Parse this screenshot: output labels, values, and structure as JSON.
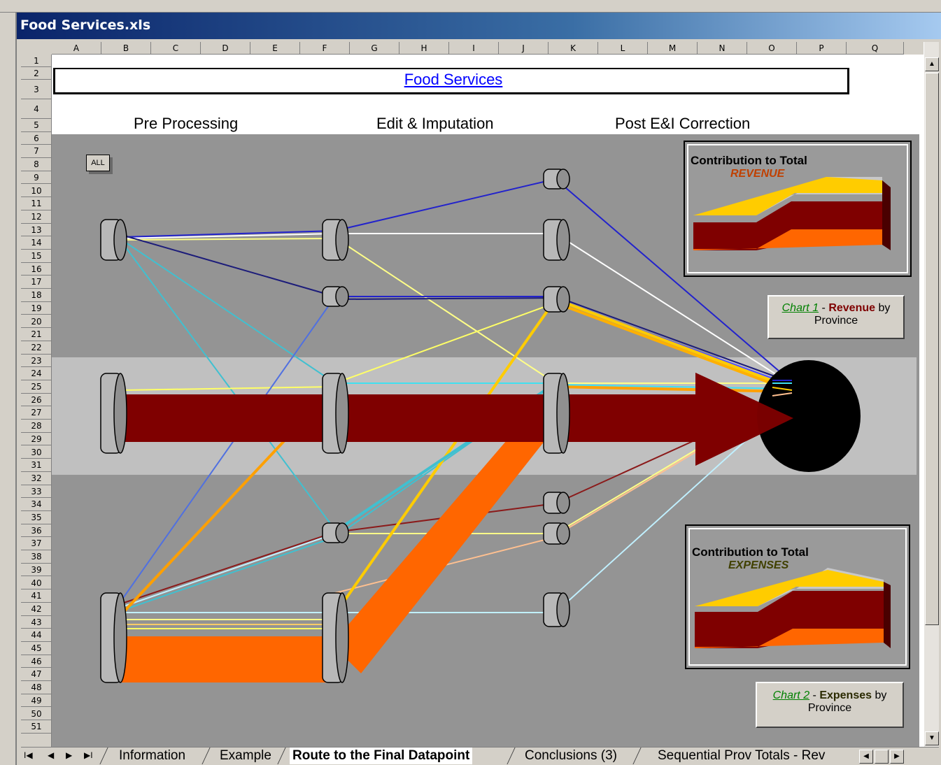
{
  "window": {
    "title": "Food Services.xls"
  },
  "columns": [
    "A",
    "B",
    "C",
    "D",
    "E",
    "F",
    "G",
    "H",
    "I",
    "J",
    "K",
    "L",
    "M",
    "N",
    "O",
    "P",
    "Q"
  ],
  "rows": [
    "1",
    "2",
    "3",
    "4",
    "5",
    "6",
    "7",
    "8",
    "9",
    "10",
    "11",
    "12",
    "13",
    "14",
    "15",
    "16",
    "17",
    "18",
    "19",
    "20",
    "21",
    "22",
    "23",
    "24",
    "25",
    "26",
    "27",
    "28",
    "29",
    "30",
    "31",
    "32",
    "33",
    "34",
    "35",
    "36",
    "37",
    "38",
    "39",
    "40",
    "41",
    "42",
    "43",
    "44",
    "45",
    "46",
    "47",
    "48",
    "49",
    "50",
    "51"
  ],
  "sheet": {
    "title_link": "Food Services",
    "stages": [
      "Pre Processing",
      "Edit & Imputation",
      "Post E&I Correction"
    ],
    "all_button": "ALL"
  },
  "charts": {
    "revenue": {
      "title": "Contribution to Total",
      "subtitle": "REVENUE",
      "subtitle_color": "#c04000"
    },
    "expenses": {
      "title": "Contribution to Total",
      "subtitle": "EXPENSES",
      "subtitle_color": "#404000"
    }
  },
  "buttons": {
    "chart1": {
      "link": "Chart 1",
      "sep": " - ",
      "bold": "Revenue",
      "rest": " by",
      "line2": "Province"
    },
    "chart2": {
      "link": "Chart 2",
      "sep": " - ",
      "bold": "Expenses",
      "rest": " by",
      "line2": "Province"
    }
  },
  "tabs": [
    "Information",
    "Example",
    "Route to the Final Datapoint",
    "Conclusions (3)",
    "Sequential Prov Totals - Rev"
  ],
  "active_tab": "Route to the Final Datapoint",
  "colors": {
    "maroon": "#7f0000",
    "orange": "#ff6600",
    "gold": "#ffcc00"
  }
}
